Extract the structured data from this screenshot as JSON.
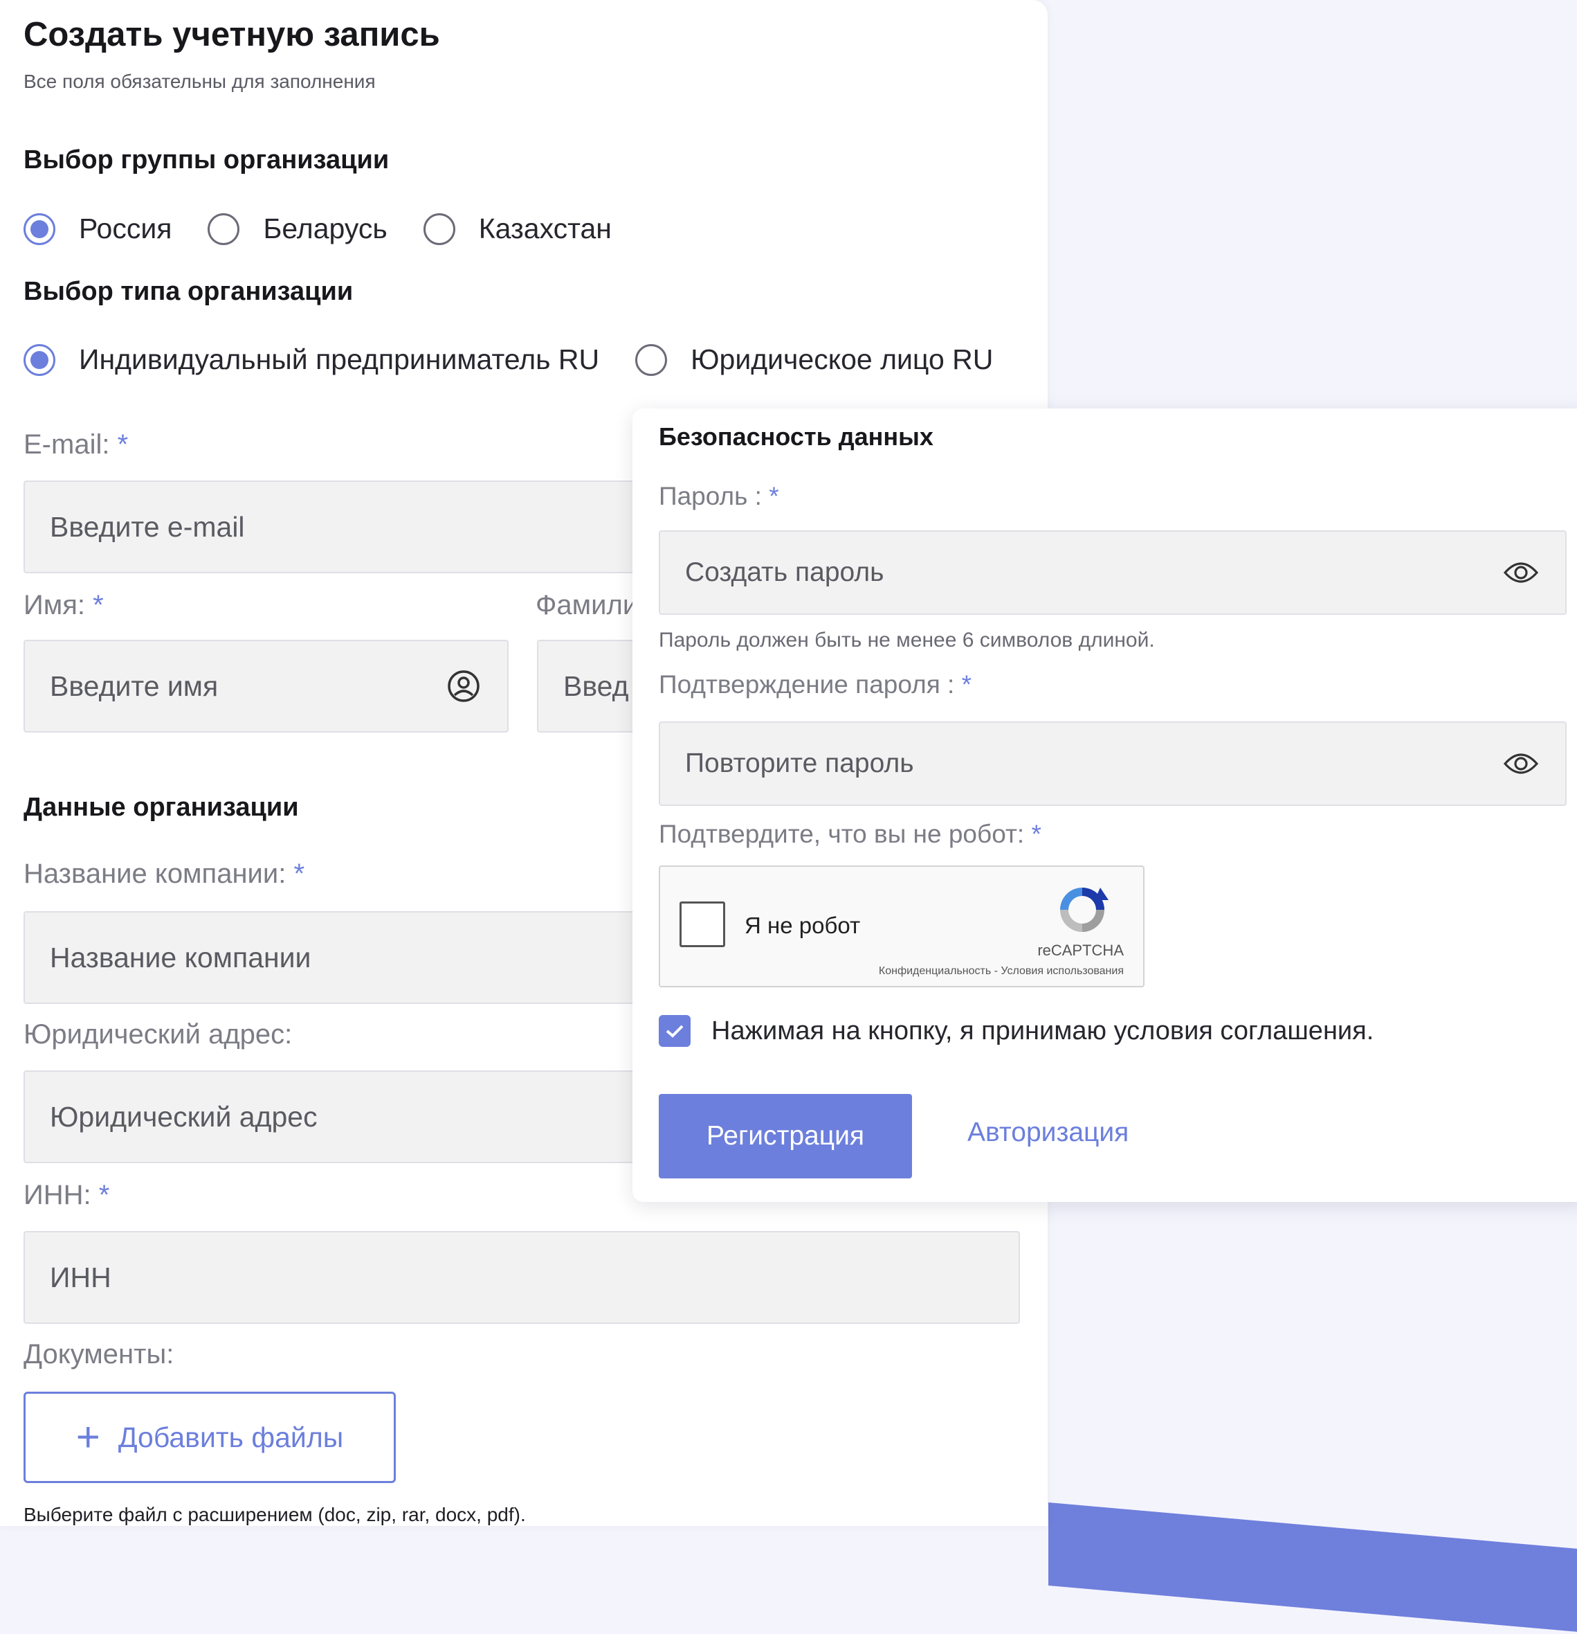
{
  "form": {
    "title": "Создать учетную запись",
    "subtitle": "Все поля обязательны для заполнения",
    "group_section": {
      "heading": "Выбор группы организации",
      "options": [
        "Россия",
        "Беларусь",
        "Казахстан"
      ],
      "selected": "Россия"
    },
    "type_section": {
      "heading": "Выбор типа организации",
      "options": [
        "Индивидуальный предприниматель RU",
        "Юридическое лицо RU"
      ],
      "selected": "Индивидуальный предприниматель RU"
    },
    "email": {
      "label": "E-mail:",
      "required": "*",
      "placeholder": "Введите e-mail",
      "value": ""
    },
    "first_name": {
      "label": "Имя:",
      "required": "*",
      "placeholder": "Введите имя",
      "value": "",
      "icon": "user-circle-icon"
    },
    "last_name": {
      "label": "Фамили",
      "placeholder": "Введ",
      "value": ""
    },
    "org_section": {
      "heading": "Данные организации"
    },
    "company": {
      "label": "Название компании:",
      "required": "*",
      "placeholder": "Название компании",
      "value": ""
    },
    "legal_address": {
      "label": "Юридический адрес:",
      "placeholder": "Юридический адрес",
      "value": ""
    },
    "inn": {
      "label": "ИНН:",
      "required": "*",
      "placeholder": "ИНН",
      "value": ""
    },
    "documents": {
      "label": "Документы:",
      "add_button": "Добавить файлы",
      "add_icon": "plus-icon",
      "hint": "Выберите файл с расширением (doc, zip, rar, docx, pdf)."
    }
  },
  "security": {
    "heading": "Безопасность данных",
    "password": {
      "label": "Пароль :",
      "required": "*",
      "placeholder": "Создать пароль",
      "value": "",
      "icon": "eye-icon"
    },
    "password_hint": "Пароль должен быть не менее 6 символов длиной.",
    "confirm": {
      "label": "Подтверждение пароля :",
      "required": "*",
      "placeholder": "Повторите пароль",
      "value": "",
      "icon": "eye-icon"
    },
    "captcha": {
      "label": "Подтвердите, что вы не робот:",
      "required": "*",
      "checkbox_text": "Я не робот",
      "brand": "reCAPTCHA",
      "links": "Конфиденциальность - Условия использования"
    },
    "agreement": {
      "text": "Нажимая на кнопку, я принимаю условия соглашения.",
      "checked": true
    },
    "register_button": "Регистрация",
    "auth_link": "Авторизация"
  },
  "colors": {
    "accent": "#6c7fdc",
    "background": "#f4f4fd",
    "input_bg": "#f2f2f2"
  }
}
